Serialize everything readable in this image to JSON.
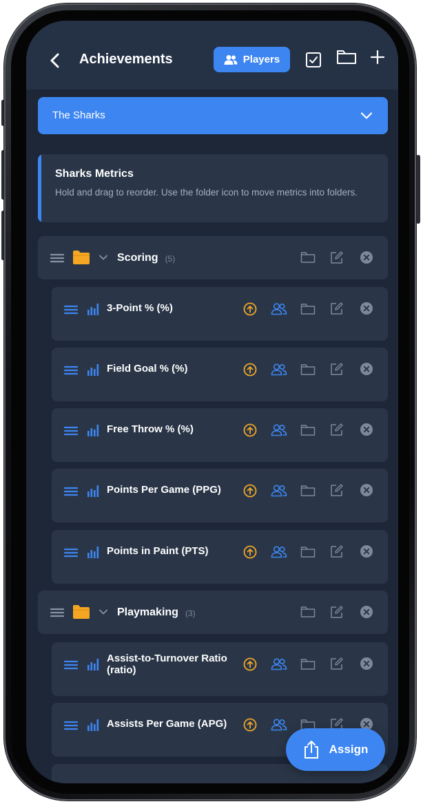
{
  "header": {
    "title": "Achievements",
    "players_label": "Players"
  },
  "team_select": {
    "value": "The Sharks"
  },
  "info_card": {
    "title": "Sharks Metrics",
    "description": "Hold and drag to reorder. Use the folder icon to move metrics into folders."
  },
  "folders": [
    {
      "name": "Scoring",
      "count": "(5)"
    },
    {
      "name": "Playmaking",
      "count": "(3)"
    }
  ],
  "metrics": [
    {
      "name": "3-Point % (%)"
    },
    {
      "name": "Field Goal % (%)"
    },
    {
      "name": "Free Throw % (%)"
    },
    {
      "name": "Points Per Game (PPG)"
    },
    {
      "name": "Points in Paint (PTS)"
    },
    {
      "name": "Assist-to-Turnover Ratio (ratio)"
    },
    {
      "name": "Assists Per Game (APG)"
    }
  ],
  "fab": {
    "label": "Assign"
  },
  "colors": {
    "accent": "#3d86f2",
    "background": "#1d2738",
    "card": "#2a3648",
    "folder": "#f5a623",
    "upload": "#f0a727",
    "muted_icon": "#7e8898"
  }
}
